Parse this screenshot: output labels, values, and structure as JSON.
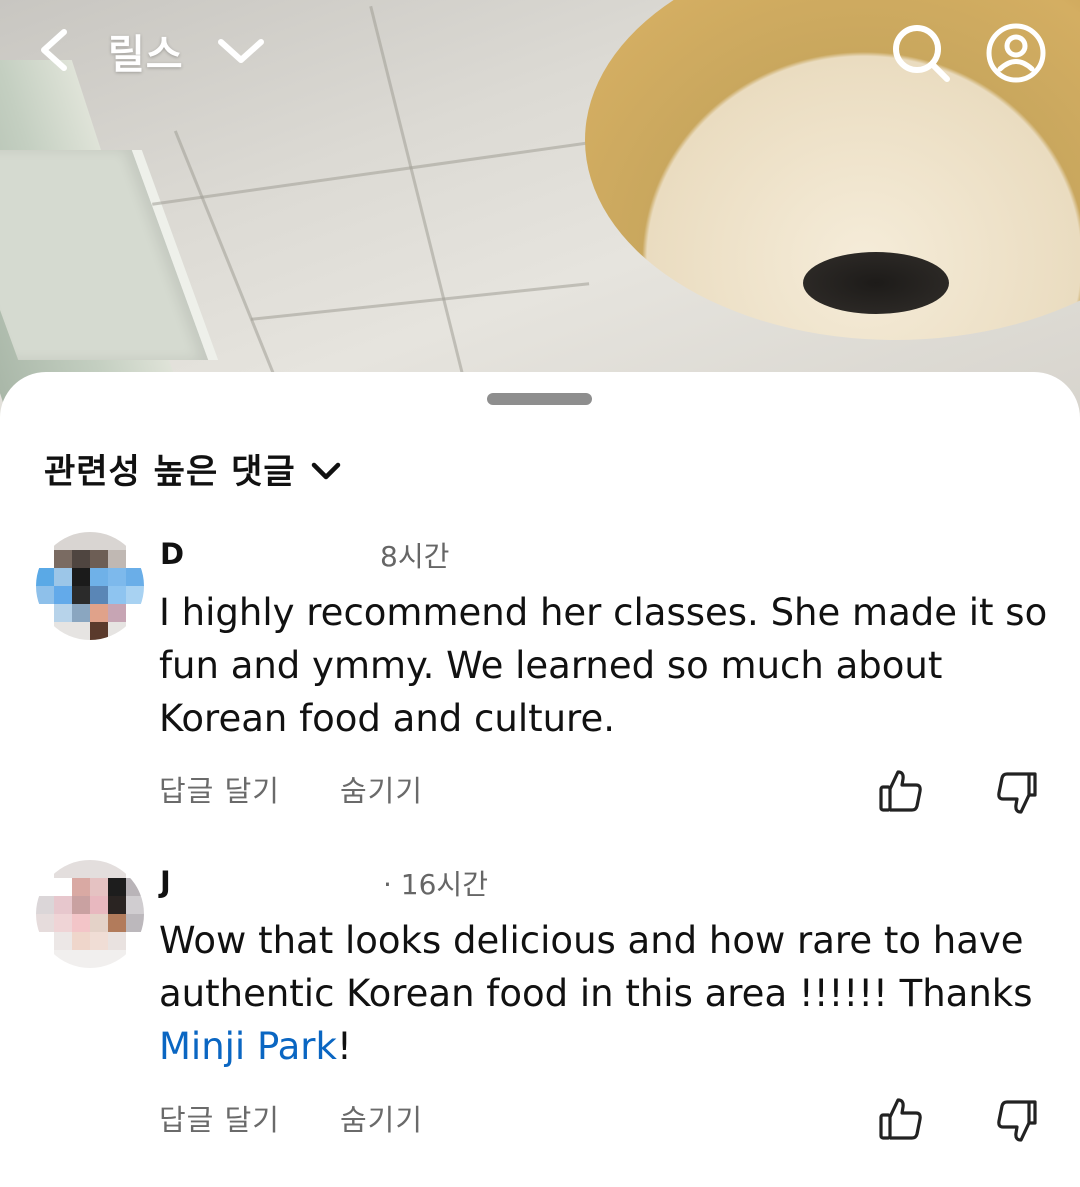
{
  "header": {
    "title": "릴스",
    "icons": [
      "back-icon",
      "chevron-down-icon",
      "search-icon",
      "profile-icon"
    ]
  },
  "sheet": {
    "sort_label": "관련성 높은 댓글"
  },
  "comments": [
    {
      "author": "D",
      "time": "8시간",
      "body": "I highly recommend her classes. She made it so fun and ymmy. We learned so much about Korean food and culture.",
      "reply_label": "답글 달기",
      "hide_label": "숨기기"
    },
    {
      "author": "J",
      "time": "· 16시간",
      "body_prefix": "Wow that looks delicious and how rare to have authentic Korean food in this area !!!!!! Thanks ",
      "mention": "Minji Park",
      "body_suffix": "!",
      "reply_label": "답글 달기",
      "hide_label": "숨기기"
    }
  ],
  "colors": {
    "mention": "#0a66c2",
    "secondary_text": "#6a6a6a",
    "handle": "#8e8e8e"
  }
}
